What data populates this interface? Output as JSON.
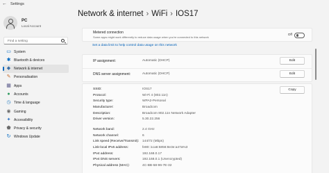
{
  "window": {
    "title": "Settings"
  },
  "profile": {
    "name": "PC",
    "account": "Local Account"
  },
  "search": {
    "placeholder": "Find a setting"
  },
  "nav": [
    {
      "label": "System",
      "icon": "monitor-icon",
      "color": "#0067c0"
    },
    {
      "label": "Bluetooth & devices",
      "icon": "bluetooth-icon",
      "color": "#0067c0"
    },
    {
      "label": "Network & internet",
      "icon": "network-icon",
      "color": "#3a6ea5",
      "active": true
    },
    {
      "label": "Personalisation",
      "icon": "brush-icon",
      "color": "#c46a2b"
    },
    {
      "label": "Apps",
      "icon": "apps-icon",
      "color": "#5a5a8a"
    },
    {
      "label": "Accounts",
      "icon": "person-icon",
      "color": "#2e9a5e"
    },
    {
      "label": "Time & language",
      "icon": "globe-clock-icon",
      "color": "#2a7fc1"
    },
    {
      "label": "Gaming",
      "icon": "gamepad-icon",
      "color": "#6b6b6b"
    },
    {
      "label": "Accessibility",
      "icon": "accessibility-icon",
      "color": "#2a6fc1"
    },
    {
      "label": "Privacy & security",
      "icon": "shield-icon",
      "color": "#6b6b6b"
    },
    {
      "label": "Windows Update",
      "icon": "update-icon",
      "color": "#0067c0"
    }
  ],
  "breadcrumb": {
    "part1": "Network & internet",
    "part2": "WiFi",
    "part3": "IOS17",
    "separator": "›"
  },
  "metered": {
    "title": "Metered connection",
    "desc": "Some apps might work differently to reduce data usage when you're connected to this network",
    "state": "Off"
  },
  "data_limit_link": "Set a data limit to help control data usage on this network",
  "ip": {
    "ip_label": "IP assignment:",
    "ip_value": "Automatic (DHCP)",
    "dns_label": "DNS server assignment:",
    "dns_value": "Automatic (DHCP)",
    "edit_label": "Edit"
  },
  "properties": {
    "copy_label": "Copy",
    "rows": [
      {
        "label": "SSID:",
        "value": "IOS17"
      },
      {
        "label": "Protocol:",
        "value": "Wi-Fi 4 (802.11n)"
      },
      {
        "label": "Security type:",
        "value": "WPA2-Personal"
      },
      {
        "label": "Manufacturer:",
        "value": "Broadcom"
      },
      {
        "label": "Description:",
        "value": "Broadcom 802.11n Network Adapter"
      },
      {
        "label": "Driver version:",
        "value": "5.30.22.256"
      },
      {
        "label": "Network band:",
        "value": "2.4 GHz"
      },
      {
        "label": "Network channel:",
        "value": "6"
      },
      {
        "label": "Link speed (Receive/Transmit):",
        "value": "144/72 (Mbps)"
      },
      {
        "label": "Link-local IPv6 address:",
        "value": "fe80::1ca6:5856:8e3e:a47a%3"
      },
      {
        "label": "IPv4 address:",
        "value": "192.168.0.17"
      },
      {
        "label": "IPv4 DNS servers:",
        "value": "192.168.0.1 (Unencrypted)"
      },
      {
        "label": "Physical address (MAC):",
        "value": "4C-BB-58-96-7E-32"
      }
    ]
  }
}
